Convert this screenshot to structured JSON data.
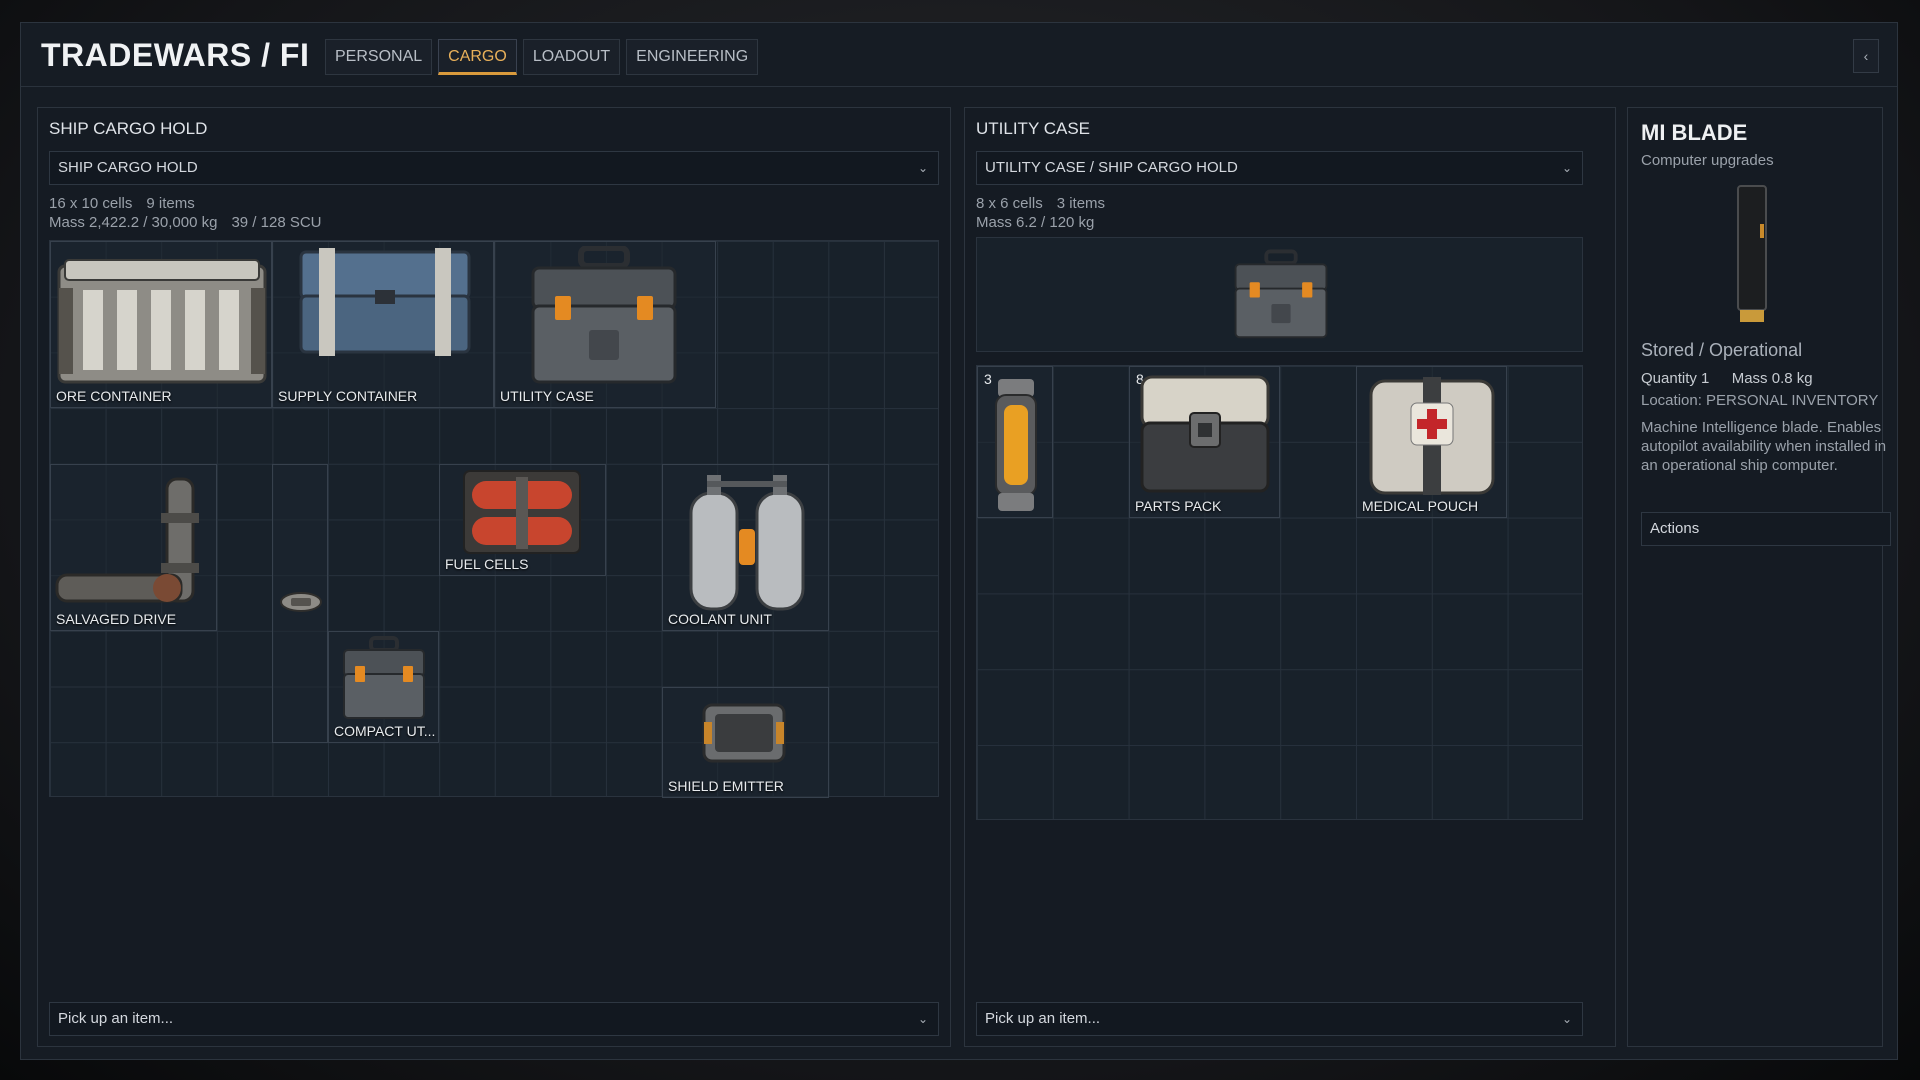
{
  "app": {
    "title": "TRADEWARS / FI",
    "collapse_glyph": "‹"
  },
  "tabs": [
    {
      "label": "PERSONAL",
      "active": false
    },
    {
      "label": "CARGO",
      "active": true
    },
    {
      "label": "LOADOUT",
      "active": false
    },
    {
      "label": "ENGINEERING",
      "active": false
    }
  ],
  "cargo_hold": {
    "title": "SHIP CARGO HOLD",
    "selector_value": "SHIP CARGO HOLD",
    "cells": "16 x 10 cells",
    "items_count": "9 items",
    "mass": "Mass 2,422.2 / 30,000 kg",
    "scu": "39 / 128 SCU",
    "items": [
      {
        "label": "ORE CONTAINER",
        "icon": "crate-icon"
      },
      {
        "label": "SUPPLY CONTAINER",
        "icon": "blue-crate-icon"
      },
      {
        "label": "UTILITY CASE",
        "icon": "utility-case-icon"
      },
      {
        "label": "SALVAGED DRIVE",
        "icon": "drive-icon"
      },
      {
        "label": "",
        "icon": "small-part-icon"
      },
      {
        "label": "FUEL CELLS",
        "icon": "fuel-cells-icon"
      },
      {
        "label": "COOLANT UNIT",
        "icon": "coolant-tanks-icon"
      },
      {
        "label": "COMPACT UT...",
        "icon": "compact-case-icon"
      },
      {
        "label": "SHIELD EMITTER",
        "icon": "shield-emitter-icon"
      }
    ],
    "pickup_placeholder": "Pick up an item..."
  },
  "utility_case": {
    "title": "UTILITY CASE",
    "selector_value": "UTILITY CASE / SHIP CARGO HOLD",
    "cells": "8 x 6 cells",
    "items_count": "3 items",
    "mass": "Mass 6.2 / 120 kg",
    "items": [
      {
        "label": "",
        "qty": "3",
        "icon": "lantern-icon"
      },
      {
        "label": "PARTS PACK",
        "qty": "8",
        "icon": "parts-pack-icon"
      },
      {
        "label": "MEDICAL POUCH",
        "qty": "",
        "icon": "medical-pouch-icon"
      }
    ],
    "pickup_placeholder": "Pick up an item..."
  },
  "details": {
    "name": "MI BLADE",
    "category": "Computer upgrades",
    "status": "Stored / Operational",
    "quantity": "Quantity 1",
    "mass": "Mass 0.8 kg",
    "location": "Location: PERSONAL INVENTORY",
    "description": "Machine Intelligence blade. Enables autopilot availability when installed in an operational ship computer.",
    "actions_label": "Actions"
  },
  "colors": {
    "accent": "#d99a3c",
    "background": "#161c24",
    "grid_line": "#27313c"
  }
}
